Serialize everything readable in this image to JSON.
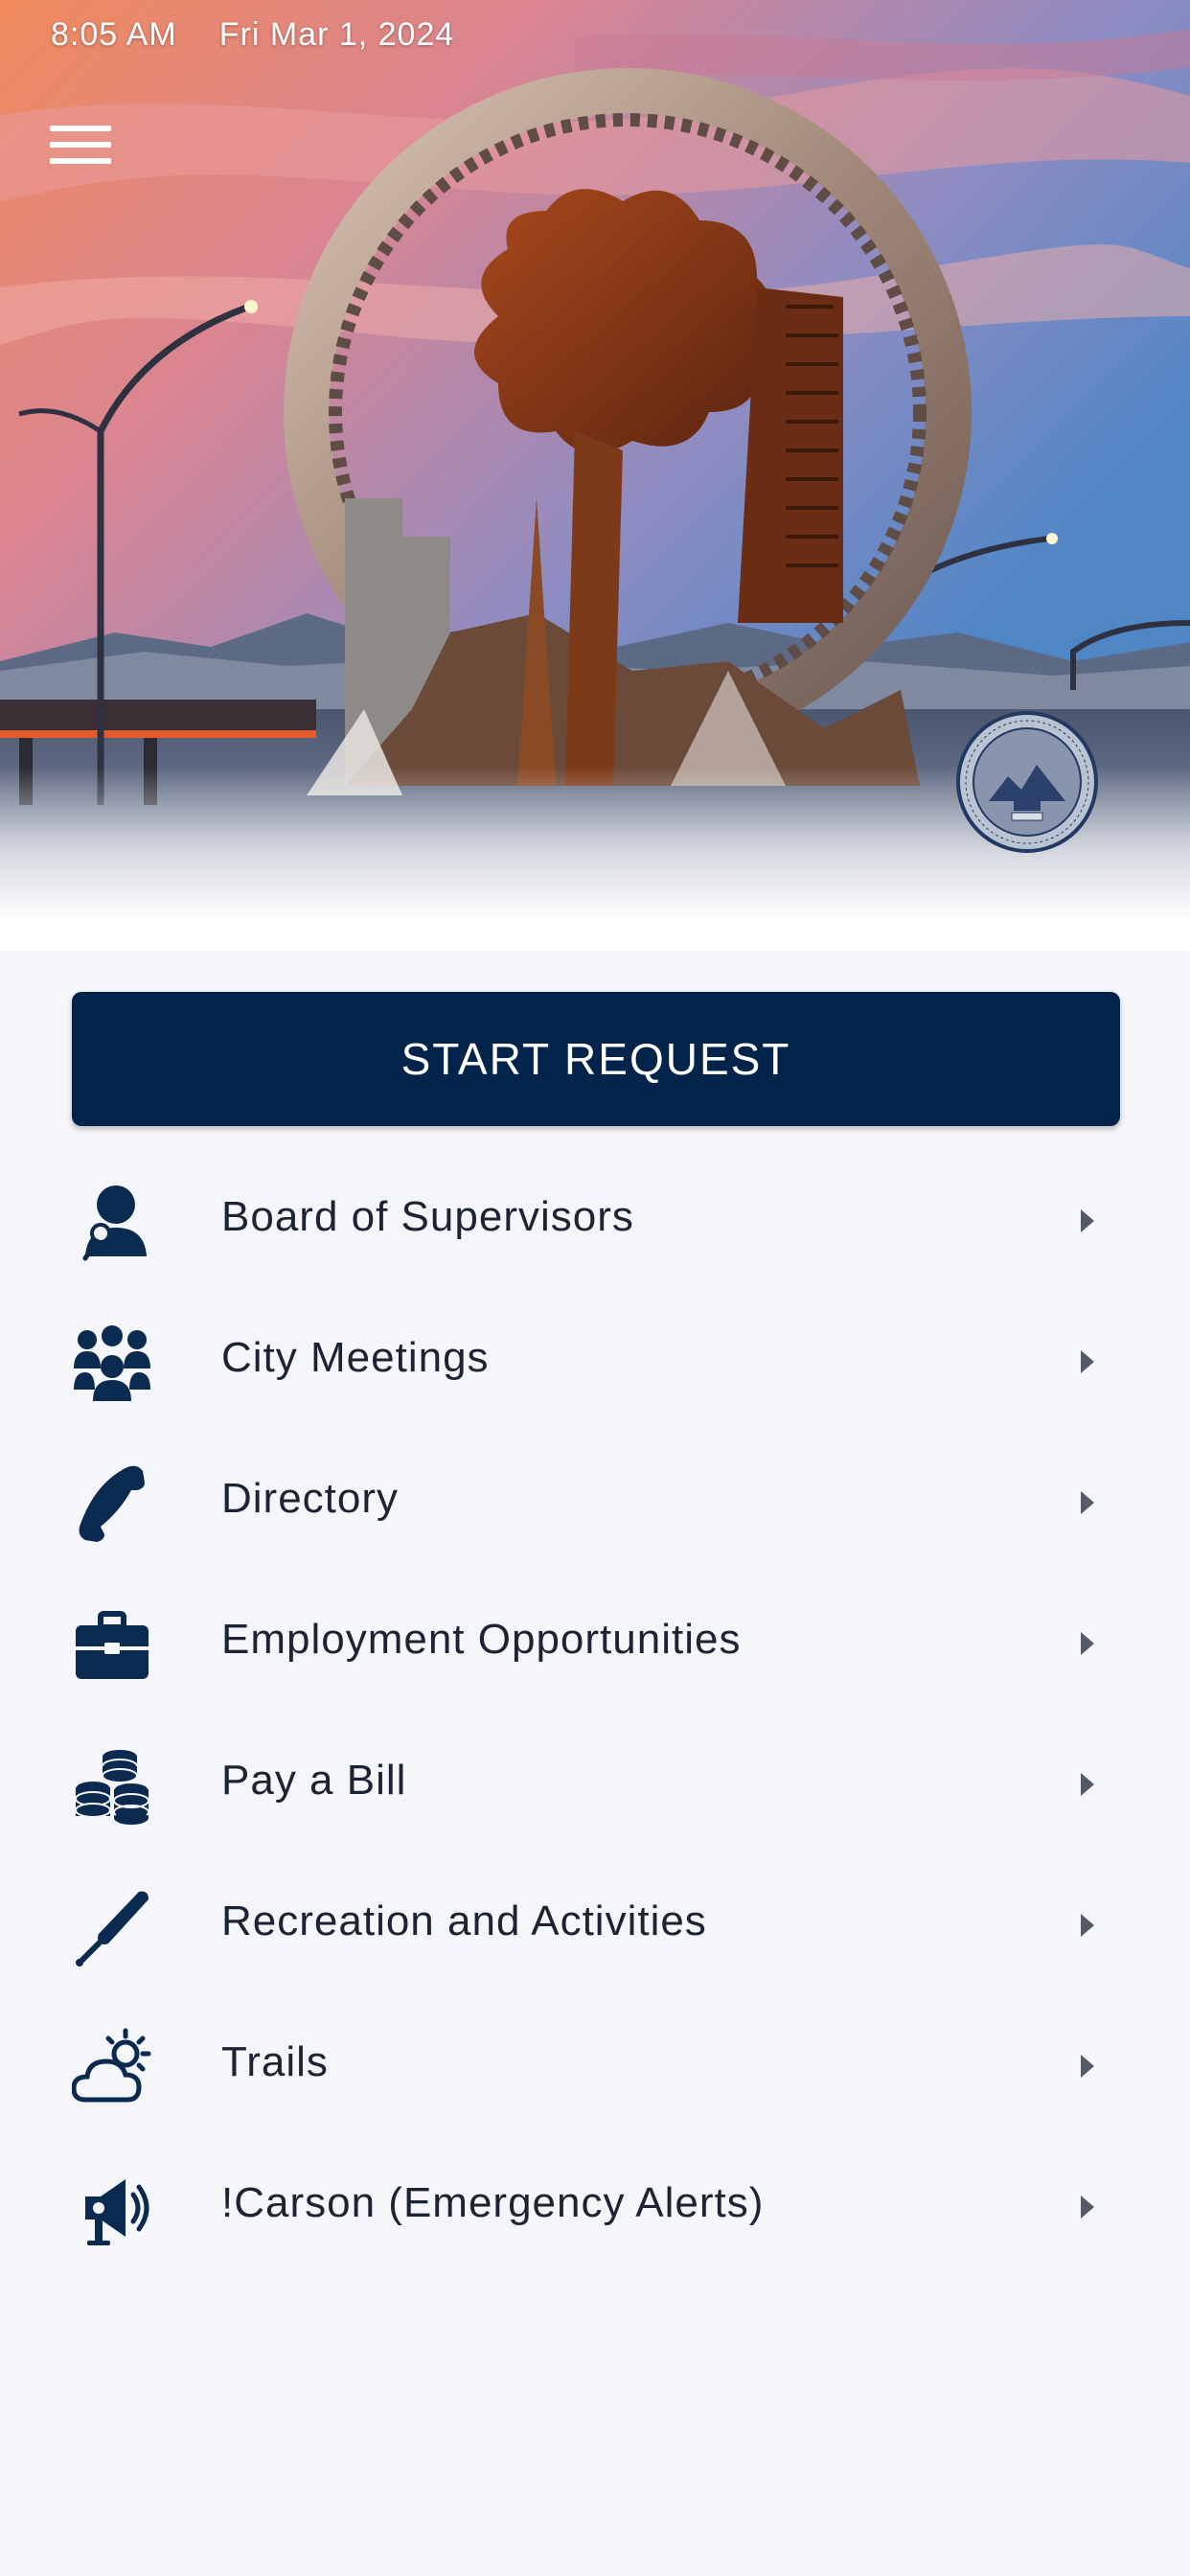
{
  "status_bar": {
    "time": "8:05 AM",
    "date": "Fri Mar 1, 2024"
  },
  "colors": {
    "brand_navy": "#02234a",
    "icon_navy": "#0a2a4f",
    "background": "#f4f6f9",
    "text": "#1c2433",
    "chevron": "#555b66"
  },
  "header": {
    "menu_icon": "hamburger-menu-icon",
    "seal_icon": "carson-city-seal"
  },
  "main": {
    "start_request_label": "START REQUEST",
    "items": [
      {
        "label": "Board of Supervisors",
        "icon": "supervisor-icon"
      },
      {
        "label": "City Meetings",
        "icon": "group-icon"
      },
      {
        "label": "Directory",
        "icon": "phone-icon"
      },
      {
        "label": "Employment Opportunities",
        "icon": "briefcase-icon"
      },
      {
        "label": "Pay a Bill",
        "icon": "coins-icon"
      },
      {
        "label": "Recreation and Activities",
        "icon": "baseball-bat-icon"
      },
      {
        "label": "Trails",
        "icon": "sun-cloud-icon"
      },
      {
        "label": "!Carson (Emergency Alerts)",
        "icon": "megaphone-icon"
      }
    ]
  }
}
